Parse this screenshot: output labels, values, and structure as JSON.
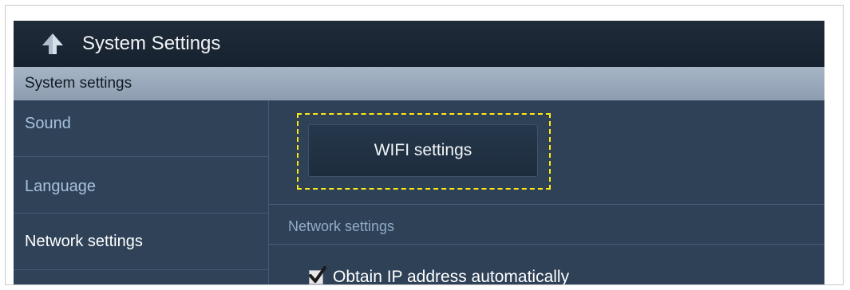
{
  "header": {
    "title": "System Settings",
    "back_icon": "up-arrow-icon"
  },
  "section": {
    "title": "System settings"
  },
  "sidebar": {
    "items": [
      {
        "label": "Sound",
        "active": false
      },
      {
        "label": "Language",
        "active": false
      },
      {
        "label": "Network settings",
        "active": true
      }
    ]
  },
  "main": {
    "wifi_button_label": "WIFI settings",
    "network_group_label": "Network settings",
    "obtain_ip_label": "Obtain IP address automatically",
    "obtain_ip_checked": true
  },
  "colors": {
    "highlight": "#ffe818",
    "title_bar": "#1f2b38",
    "section_bar": "#9aaabc",
    "panel": "#2e4157"
  }
}
